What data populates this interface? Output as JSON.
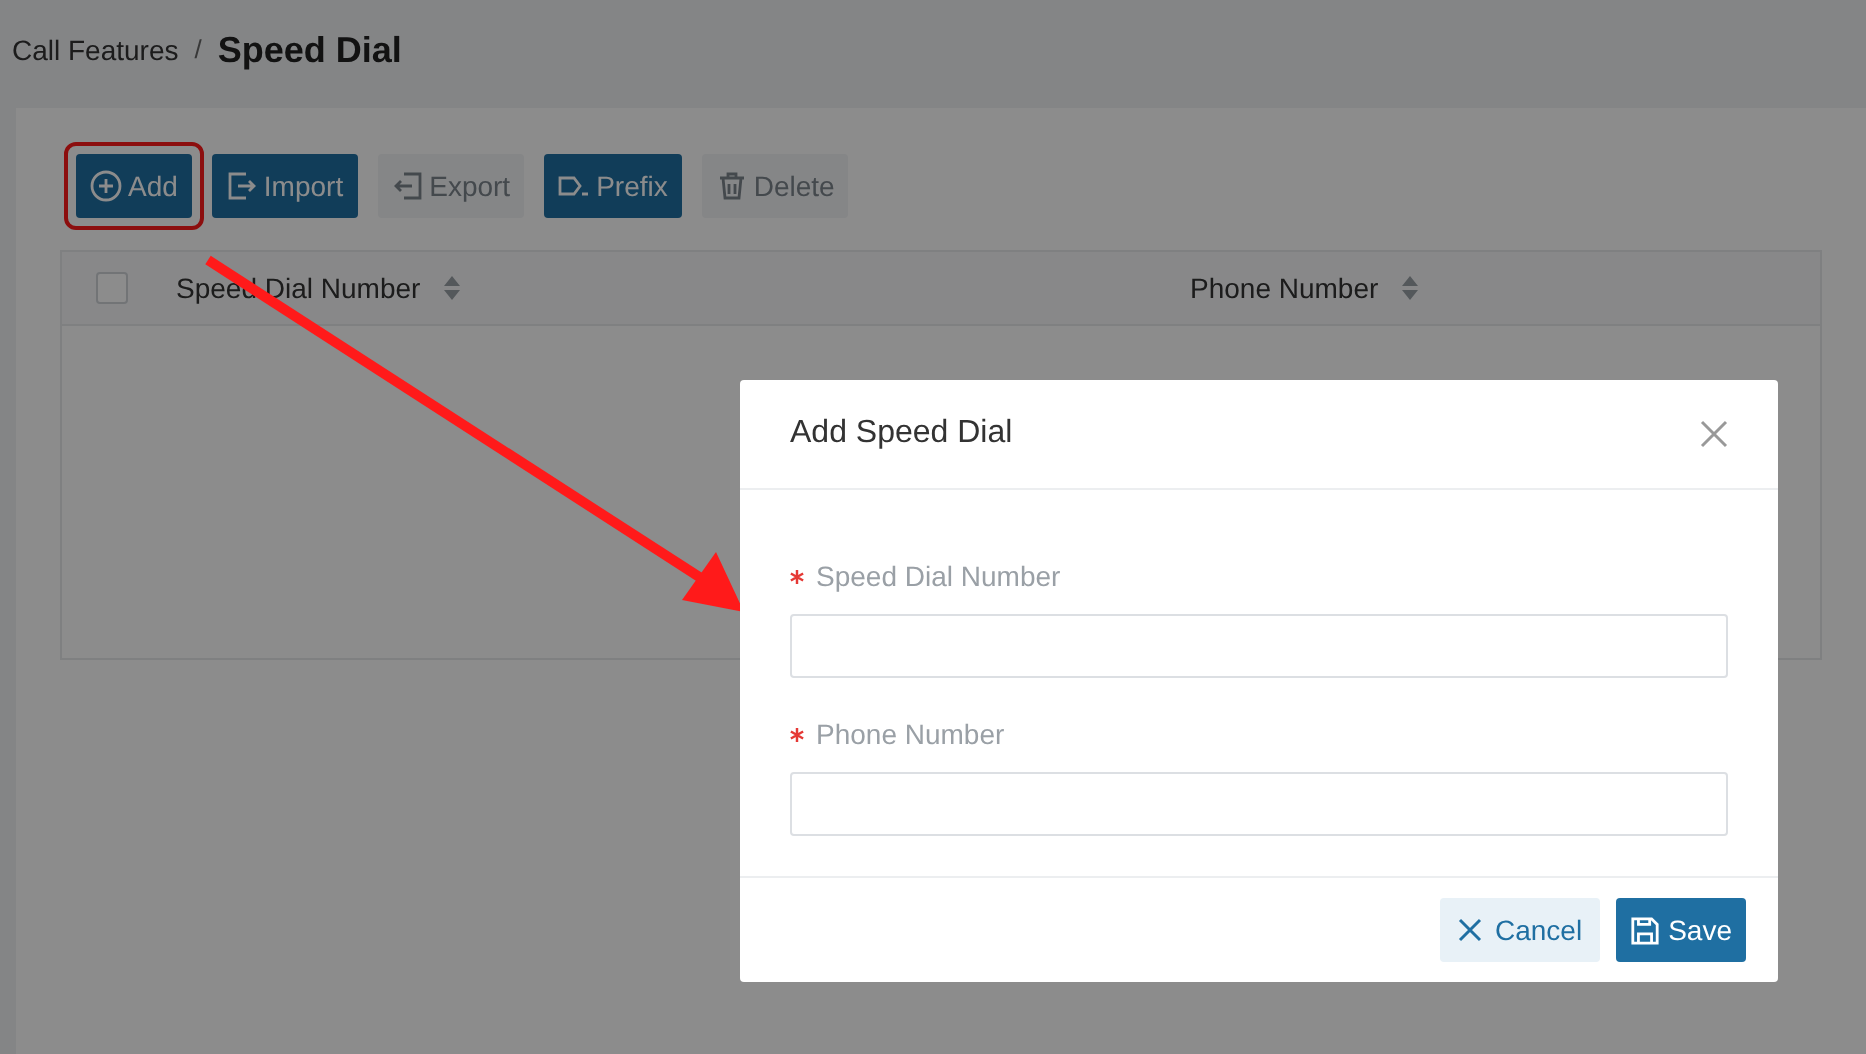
{
  "breadcrumb": {
    "parent": "Call Features",
    "separator": "/",
    "current": "Speed Dial"
  },
  "toolbar": [
    {
      "kind": "add",
      "label": "Add",
      "disabled": false,
      "highlighted": true
    },
    {
      "kind": "import",
      "label": "Import",
      "disabled": false,
      "highlighted": false
    },
    {
      "kind": "export",
      "label": "Export",
      "disabled": true,
      "highlighted": false
    },
    {
      "kind": "prefix",
      "label": "Prefix",
      "disabled": false,
      "highlighted": false
    },
    {
      "kind": "delete",
      "label": "Delete",
      "disabled": true,
      "highlighted": false
    }
  ],
  "table": {
    "select_all": {
      "checked": false
    },
    "columns": [
      "Speed Dial Number",
      "Phone Number"
    ]
  },
  "dialog": {
    "title": "Add Speed Dial",
    "fields": [
      {
        "label": "Speed Dial Number",
        "required": true
      },
      {
        "label": "Phone Number",
        "required": true
      }
    ],
    "buttons": [
      {
        "kind": "cancel",
        "label": "Cancel"
      },
      {
        "kind": "save",
        "label": "Save"
      }
    ]
  },
  "annotation": {
    "arrow": true
  }
}
